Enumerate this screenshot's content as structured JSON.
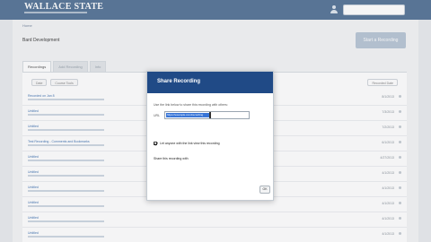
{
  "header": {
    "logo_text": "WALLACE STATE",
    "search_placeholder": ""
  },
  "page": {
    "breadcrumb": "Home",
    "course_title": "Bard Development",
    "start_button_label": "Start a Recording"
  },
  "tabs": [
    {
      "label": "Recordings",
      "active": true
    },
    {
      "label": "Add Recording",
      "active": false
    },
    {
      "label": "Info",
      "active": false
    }
  ],
  "filters": [
    {
      "label": "Date"
    },
    {
      "label": "Course Tools"
    }
  ],
  "sort_label": "Recorded Date",
  "recordings": [
    {
      "title": "Recorded on Jan 8",
      "date": "8/1/2013"
    },
    {
      "title": "Untitled",
      "date": "7/3/2013"
    },
    {
      "title": "Untitled",
      "date": "7/2/2013"
    },
    {
      "title": "Test Recording - Comments and Bookmarks",
      "date": "6/1/2013"
    },
    {
      "title": "Untitled",
      "date": "4/27/2013"
    },
    {
      "title": "Untitled",
      "date": "4/1/2013"
    },
    {
      "title": "Untitled",
      "date": "4/1/2013"
    },
    {
      "title": "Untitled",
      "date": "4/1/2013"
    },
    {
      "title": "Untitled",
      "date": "4/1/2013"
    },
    {
      "title": "Untitled",
      "date": "4/1/2013"
    }
  ],
  "modal": {
    "title": "Share Recording",
    "description": "Use the link below to share this recording with others:",
    "url_label": "URL",
    "url_value": "https://example.com/recording",
    "checkbox_checked": true,
    "checkbox_label": "Let anyone with the link view this recording",
    "share_link_label": "Share this recording with",
    "ok_label": "OK"
  }
}
